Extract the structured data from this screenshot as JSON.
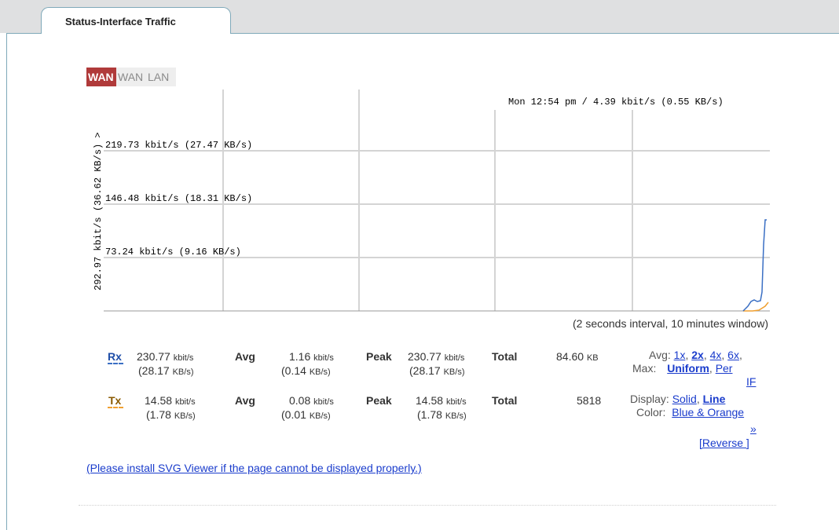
{
  "main_tab": {
    "label": "Status-Interface Traffic"
  },
  "interface_tabs": [
    {
      "label": "WAN",
      "active": true
    },
    {
      "label": "WAN",
      "active": false
    },
    {
      "label": "LAN",
      "active": false
    }
  ],
  "graph": {
    "y_axis_label": "292.97 kbit/s (36.62 KB/s) >",
    "levels": [
      {
        "label": "219.73 kbit/s (27.47 KB/s)",
        "kbit": 219.73
      },
      {
        "label": "146.48 kbit/s (18.31 KB/s)",
        "kbit": 146.48
      },
      {
        "label": "73.24 kbit/s (9.16 KB/s)",
        "kbit": 73.24
      }
    ],
    "max_kbit": 292.97,
    "tooltip": "Mon 12:54 pm / 4.39 kbit/s (0.55 KB/s)",
    "rx_color": "#3a6fc4",
    "tx_color": "#f0a030",
    "interval_note": "(2 seconds interval, 10 minutes window)"
  },
  "stats": {
    "rx": {
      "key": "Rx",
      "rate": "230.77",
      "rate_unit": "kbit/s",
      "rate_kb": "(28.17",
      "rate_kb_unit": "KB/s)",
      "avg_label": "Avg",
      "avg": "1.16",
      "avg_unit": "kbit/s",
      "avg_kb": "(0.14",
      "avg_kb_unit": "KB/s)",
      "peak_label": "Peak",
      "peak": "230.77",
      "peak_unit": "kbit/s",
      "peak_kb": "(28.17",
      "peak_kb_unit": "KB/s)",
      "total_label": "Total",
      "total": "84.60",
      "total_unit": "KB"
    },
    "tx": {
      "key": "Tx",
      "rate": "14.58",
      "rate_unit": "kbit/s",
      "rate_kb": "(1.78",
      "rate_kb_unit": "KB/s)",
      "avg_label": "Avg",
      "avg": "0.08",
      "avg_unit": "kbit/s",
      "avg_kb": "(0.01",
      "avg_kb_unit": "KB/s)",
      "peak_label": "Peak",
      "peak": "14.58",
      "peak_unit": "kbit/s",
      "peak_kb": "(1.78",
      "peak_kb_unit": "KB/s)",
      "total_label": "Total",
      "total": "5818"
    }
  },
  "controls": {
    "avg_label": "Avg:",
    "avg_options": [
      "1x",
      "2x",
      "4x",
      "6x"
    ],
    "max_label": "Max:",
    "max_uniform": "Uniform",
    "max_per": "Per",
    "max_if": "IF",
    "display_label": "Display:",
    "display_solid": "Solid",
    "display_line": "Line",
    "color_label": "Color:",
    "color_value": "Blue & Orange",
    "more": "»",
    "reverse": "[Reverse ]"
  },
  "svg_note": "(Please install SVG Viewer if the page cannot be displayed properly.)"
}
